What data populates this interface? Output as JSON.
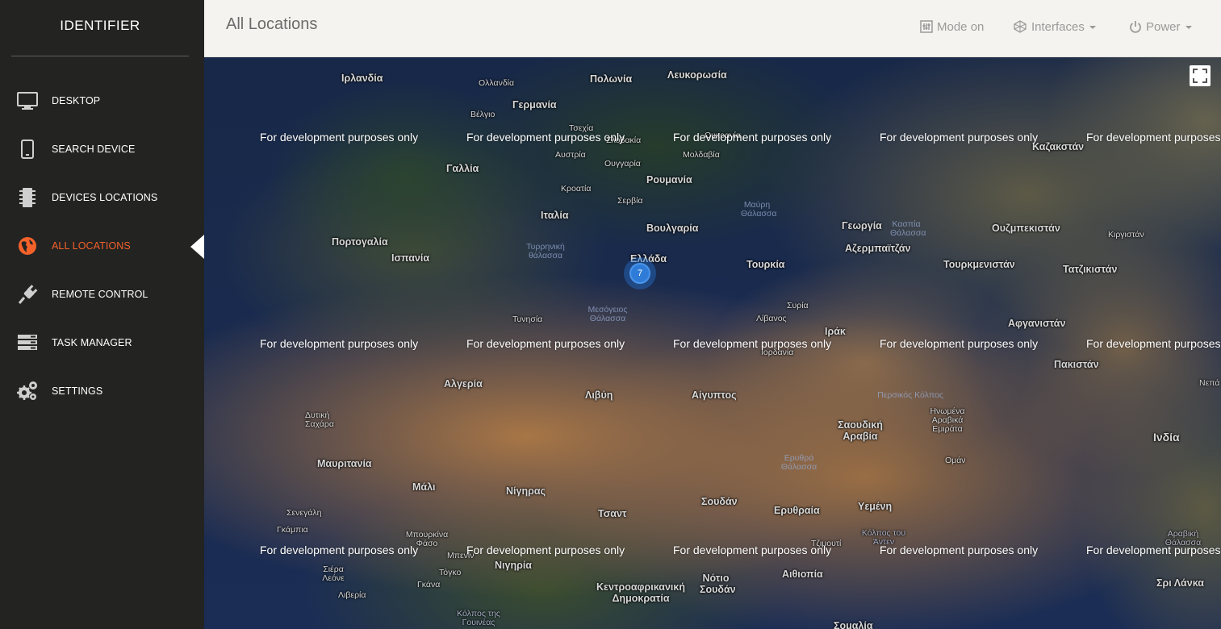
{
  "sidebar": {
    "brand": "IDENTIFIER",
    "items": [
      {
        "label": "DESKTOP",
        "icon": "monitor-icon"
      },
      {
        "label": "SEARCH DEVICE",
        "icon": "tablet-icon"
      },
      {
        "label": "DEVICES LOCATIONS",
        "icon": "chip-icon"
      },
      {
        "label": "ALL LOCATIONS",
        "icon": "globe-icon",
        "active": true
      },
      {
        "label": "REMOTE CONTROL",
        "icon": "plug-icon"
      },
      {
        "label": "TASK MANAGER",
        "icon": "server-icon"
      },
      {
        "label": "SETTINGS",
        "icon": "gears-icon"
      }
    ],
    "active_color": "#f4622a"
  },
  "header": {
    "title": "All Locations",
    "mode_label": "Mode on",
    "interfaces_label": "Interfaces",
    "power_label": "Power"
  },
  "map": {
    "watermark": "For development purposes only",
    "cluster_count": "7",
    "places": {
      "irlandia": "Ιρλανδία",
      "ollandia": "Ολλανδία",
      "polonia": "Πολωνία",
      "lefkorosia": "Λευκορωσία",
      "vegio": "Βέλγιο",
      "germania": "Γερμανία",
      "tsechia": "Τσεχία",
      "slovakia": "Σλοβακία",
      "ukraine": "Ουκρανία",
      "kazakhstan": "Καζακστάν",
      "austria": "Αυστρία",
      "moldavia": "Μολδαβία",
      "gallia": "Γαλλία",
      "oungaria": "Ουγγαρία",
      "roumania": "Ρουμανία",
      "kroatia": "Κροατία",
      "servia": "Σερβία",
      "italia": "Ιταλία",
      "voulgaria": "Βουλγαρία",
      "georgia": "Γεωργία",
      "ouzbekistan": "Ουζμπεκιστάν",
      "kirgistan": "Κιργιστάν",
      "portogalia": "Πορτογαλία",
      "ispania": "Ισπανία",
      "azerbaitzan": "Αζερμπαϊτζάν",
      "ellada": "Ελλάδα",
      "tourkia": "Τουρκία",
      "tourkmenistan": "Τουρκμενιστάν",
      "tatzikistan": "Τατζικιστάν",
      "syria": "Συρία",
      "tynisia": "Τυνησία",
      "livanos": "Λίβανος",
      "irak": "Ιράκ",
      "afganistan": "Αφγανιστάν",
      "iordania": "Ιορδανία",
      "pakistan": "Πακιστάν",
      "algeria": "Αλγερία",
      "livi": "Λιβύη",
      "aigyptos": "Αίγυπτος",
      "nepal": "Νεπά",
      "dytiki_sahara": "Δυτική Σαχάρα",
      "saoudiki_aravia": "Σαουδική Αραβία",
      "inomena_emirata": "Ηνωμένα Αραβικά Εμιράτα",
      "india": "Ινδία",
      "oman": "Ομάν",
      "mavritania": "Μαυριτανία",
      "mali": "Μάλι",
      "nigiras": "Νίγηρας",
      "soudan": "Σουδάν",
      "eruthraia": "Ερυθραία",
      "yemeni": "Υεμένη",
      "senegali": "Σενεγάλη",
      "tsant": "Τσαντ",
      "gkampia": "Γκάμπια",
      "mpourkina": "Μπουρκίνα Φάσο",
      "tzimouti": "Τζιμουτί",
      "arabiki_thalassa": "Αραβική Θάλασσα",
      "siera_leone": "Σιέρα Λεόνε",
      "togko": "Τόγκο",
      "nigiria": "Νιγηρία",
      "mpenin": "Μπενίν",
      "kentroafrikaniki": "Κεντροαφρικανική Δημοκρατία",
      "notio_soudan": "Νότιο Σουδάν",
      "aithiopia": "Αιθιοπία",
      "sri_lanka": "Σρι Λάνκα",
      "liveria": "Λιβερία",
      "gkana": "Γκάνα",
      "kolpos_gouineas": "Κόλπος της Γουινέας",
      "somalia": "Σομαλία",
      "kolpos_aden": "Κόλπος του Άντεν"
    },
    "seas": {
      "mavri": "Μαύρη Θάλασσα",
      "kaspia": "Κασπία Θάλασσα",
      "tyrrinikh": "Τυρρηνική θάλασσα",
      "mesogeios": "Μεσόγειος Θάλασσα",
      "persikos": "Περσικός Κόλπος",
      "erythra": "Ερυθρά Θάλασσα"
    }
  }
}
